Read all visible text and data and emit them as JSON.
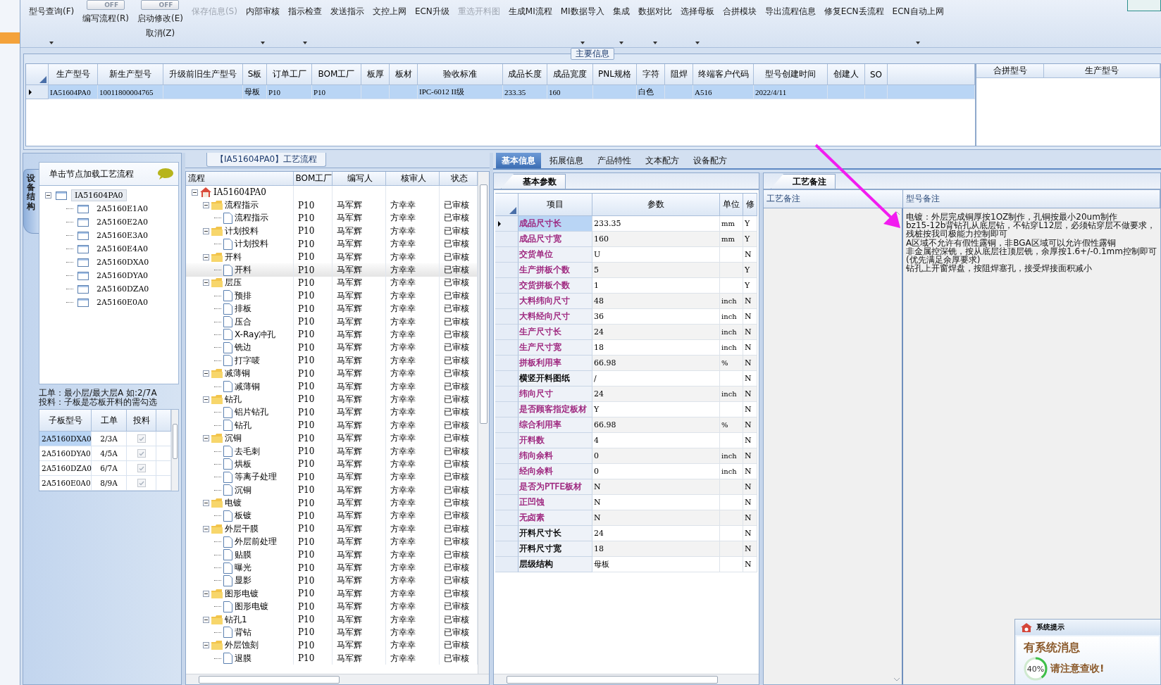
{
  "toolbar": [
    {
      "kind": "button",
      "label": "型号查询(F)",
      "menu": true,
      "disabled": false
    },
    {
      "kind": "toggle",
      "switch": "OFF",
      "on": false,
      "label": "编写流程(R)",
      "menu": false,
      "disabled": false
    },
    {
      "kind": "toggle",
      "switch": "OFF",
      "on": false,
      "label": "启动修改(E)",
      "sublabel": "取消(Z)",
      "menu": false,
      "disabled": false
    },
    {
      "kind": "button",
      "label": "保存信息(S)",
      "menu": false,
      "disabled": true
    },
    {
      "kind": "button",
      "label": "内部审核",
      "menu": true,
      "disabled": false
    },
    {
      "kind": "button",
      "label": "指示检查",
      "menu": true,
      "disabled": false
    },
    {
      "kind": "button",
      "label": "发送指示",
      "menu": false,
      "disabled": false
    },
    {
      "kind": "button",
      "label": "文控上网",
      "menu": false,
      "disabled": false
    },
    {
      "kind": "button",
      "label": "ECN升级",
      "menu": false,
      "disabled": false
    },
    {
      "kind": "button",
      "label": "重选开料图",
      "menu": false,
      "disabled": true
    },
    {
      "kind": "button",
      "label": "生成MI流程",
      "menu": false,
      "disabled": false
    },
    {
      "kind": "button",
      "label": "MI数据导入",
      "menu": true,
      "disabled": false
    },
    {
      "kind": "button",
      "label": "集成",
      "menu": true,
      "disabled": false
    },
    {
      "kind": "button",
      "label": "数据对比",
      "menu": true,
      "disabled": false
    },
    {
      "kind": "button",
      "label": "选择母板",
      "menu": true,
      "disabled": false
    },
    {
      "kind": "button",
      "label": "合拼模块",
      "menu": false,
      "disabled": false
    },
    {
      "kind": "button",
      "label": "导出流程信息",
      "menu": false,
      "disabled": false
    },
    {
      "kind": "button",
      "label": "修复ECN丢流程",
      "menu": false,
      "disabled": false
    },
    {
      "kind": "button",
      "label": "ECN自动上网",
      "menu": true,
      "disabled": false
    }
  ],
  "main_info": {
    "title": "主要信息",
    "columns": [
      "生产型号",
      "新生产型号",
      "升级前旧生产型号",
      "S板",
      "订单工厂",
      "BOM工厂",
      "板厚",
      "板材",
      "验收标准",
      "成品长度",
      "成品宽度",
      "PNL规格",
      "字符",
      "阻焊",
      "终端客户代码",
      "型号创建时间",
      "创建人",
      "SO"
    ],
    "rows": [
      {
        "selected": true,
        "cells": [
          "IA51604PA0",
          "10011800004765",
          null,
          "母板",
          "P10",
          "P10",
          null,
          null,
          "IPC-6012 II级",
          "233.35",
          "160",
          null,
          "白色",
          null,
          "A516",
          "2022/4/11",
          null,
          null
        ]
      }
    ],
    "merge_columns": [
      "合拼型号",
      "生产型号"
    ]
  },
  "structure_panel": {
    "side_tab": "设备结构",
    "header": "单击节点加载工艺流程",
    "tree": {
      "label": "IA51604PA0",
      "expanded": true,
      "selected": true,
      "children": [
        {
          "label": "2A5160E1A0",
          "selected": false
        },
        {
          "label": "2A5160E2A0",
          "selected": false
        },
        {
          "label": "2A5160E3A0",
          "selected": false
        },
        {
          "label": "2A5160E4A0",
          "selected": false
        },
        {
          "label": "2A5160DXA0",
          "selected": false
        },
        {
          "label": "2A5160DYA0",
          "selected": false
        },
        {
          "label": "2A5160DZA0",
          "selected": false
        },
        {
          "label": "2A5160E0A0",
          "selected": false
        }
      ]
    },
    "hint": "工单：最小层/最大层A 如:2/7A\n投料：子板是芯板开料的需勾选",
    "columns": [
      "子板型号",
      "工单",
      "投料"
    ],
    "rows": [
      {
        "board": "2A5160DXA0",
        "order": "2/3A",
        "feed": true,
        "selected": true
      },
      {
        "board": "2A5160DYA0",
        "order": "4/5A",
        "feed": true,
        "selected": false
      },
      {
        "board": "2A5160DZA0",
        "order": "6/7A",
        "feed": true,
        "selected": false
      },
      {
        "board": "2A5160E0A0",
        "order": "8/9A",
        "feed": true,
        "selected": false
      }
    ]
  },
  "flow_panel": {
    "title": "【IA51604PA0】工艺流程",
    "columns": [
      "流程",
      "BOM工厂",
      "编写人",
      "核审人",
      "状态"
    ],
    "tree": {
      "kind": "root",
      "label": "IA51604PA0",
      "expanded": true,
      "selected": false,
      "children": [
        {
          "kind": "folder",
          "label": "流程指示",
          "bom": "P10",
          "author": "马军辉",
          "reviewer": "方幸幸",
          "status": "已审核",
          "expanded": true,
          "selected": false,
          "children": [
            {
              "kind": "step",
              "label": "流程指示",
              "bom": "P10",
              "author": "马军辉",
              "reviewer": "方幸幸",
              "status": "已审核",
              "selected": false
            }
          ]
        },
        {
          "kind": "folder",
          "label": "计划投料",
          "bom": "P10",
          "author": "马军辉",
          "reviewer": "方幸幸",
          "status": "已审核",
          "expanded": true,
          "selected": false,
          "children": [
            {
              "kind": "step",
              "label": "计划投料",
              "bom": "P10",
              "author": "马军辉",
              "reviewer": "方幸幸",
              "status": "已审核",
              "selected": false
            }
          ]
        },
        {
          "kind": "folder",
          "label": "开料",
          "bom": "P10",
          "author": "马军辉",
          "reviewer": "方幸幸",
          "status": "已审核",
          "expanded": true,
          "selected": false,
          "children": [
            {
              "kind": "step",
              "label": "开料",
              "bom": "P10",
              "author": "马军辉",
              "reviewer": "方幸幸",
              "status": "已审核",
              "selected": true
            }
          ]
        },
        {
          "kind": "folder",
          "label": "层压",
          "bom": "P10",
          "author": "马军辉",
          "reviewer": "方幸幸",
          "status": "已审核",
          "expanded": true,
          "selected": false,
          "children": [
            {
              "kind": "step",
              "label": "预排",
              "bom": "P10",
              "author": "马军辉",
              "reviewer": "方幸幸",
              "status": "已审核",
              "selected": false
            },
            {
              "kind": "step",
              "label": "排板",
              "bom": "P10",
              "author": "马军辉",
              "reviewer": "方幸幸",
              "status": "已审核",
              "selected": false
            },
            {
              "kind": "step",
              "label": "压合",
              "bom": "P10",
              "author": "马军辉",
              "reviewer": "方幸幸",
              "status": "已审核",
              "selected": false
            },
            {
              "kind": "step",
              "label": "X-Ray冲孔",
              "bom": "P10",
              "author": "马军辉",
              "reviewer": "方幸幸",
              "status": "已审核",
              "selected": false
            },
            {
              "kind": "step",
              "label": "铣边",
              "bom": "P10",
              "author": "马军辉",
              "reviewer": "方幸幸",
              "status": "已审核",
              "selected": false
            },
            {
              "kind": "step",
              "label": "打字唛",
              "bom": "P10",
              "author": "马军辉",
              "reviewer": "方幸幸",
              "status": "已审核",
              "selected": false
            }
          ]
        },
        {
          "kind": "folder",
          "label": "减薄铜",
          "bom": "P10",
          "author": "马军辉",
          "reviewer": "方幸幸",
          "status": "已审核",
          "expanded": true,
          "selected": false,
          "children": [
            {
              "kind": "step",
              "label": "减薄铜",
              "bom": "P10",
              "author": "马军辉",
              "reviewer": "方幸幸",
              "status": "已审核",
              "selected": false
            }
          ]
        },
        {
          "kind": "folder",
          "label": "钻孔",
          "bom": "P10",
          "author": "马军辉",
          "reviewer": "方幸幸",
          "status": "已审核",
          "expanded": true,
          "selected": false,
          "children": [
            {
              "kind": "step",
              "label": "铝片钻孔",
              "bom": "P10",
              "author": "马军辉",
              "reviewer": "方幸幸",
              "status": "已审核",
              "selected": false
            },
            {
              "kind": "step",
              "label": "钻孔",
              "bom": "P10",
              "author": "马军辉",
              "reviewer": "方幸幸",
              "status": "已审核",
              "selected": false
            }
          ]
        },
        {
          "kind": "folder",
          "label": "沉铜",
          "bom": "P10",
          "author": "马军辉",
          "reviewer": "方幸幸",
          "status": "已审核",
          "expanded": true,
          "selected": false,
          "children": [
            {
              "kind": "step",
              "label": "去毛刺",
              "bom": "P10",
              "author": "马军辉",
              "reviewer": "方幸幸",
              "status": "已审核",
              "selected": false
            },
            {
              "kind": "step",
              "label": "烘板",
              "bom": "P10",
              "author": "马军辉",
              "reviewer": "方幸幸",
              "status": "已审核",
              "selected": false
            },
            {
              "kind": "step",
              "label": "等离子处理",
              "bom": "P10",
              "author": "马军辉",
              "reviewer": "方幸幸",
              "status": "已审核",
              "selected": false
            },
            {
              "kind": "step",
              "label": "沉铜",
              "bom": "P10",
              "author": "马军辉",
              "reviewer": "方幸幸",
              "status": "已审核",
              "selected": false
            }
          ]
        },
        {
          "kind": "folder",
          "label": "电镀",
          "bom": "P10",
          "author": "马军辉",
          "reviewer": "方幸幸",
          "status": "已审核",
          "expanded": true,
          "selected": false,
          "children": [
            {
              "kind": "step",
              "label": "板镀",
              "bom": "P10",
              "author": "马军辉",
              "reviewer": "方幸幸",
              "status": "已审核",
              "selected": false
            }
          ]
        },
        {
          "kind": "folder",
          "label": "外层干膜",
          "bom": "P10",
          "author": "马军辉",
          "reviewer": "方幸幸",
          "status": "已审核",
          "expanded": true,
          "selected": false,
          "children": [
            {
              "kind": "step",
              "label": "外层前处理",
              "bom": "P10",
              "author": "马军辉",
              "reviewer": "方幸幸",
              "status": "已审核",
              "selected": false
            },
            {
              "kind": "step",
              "label": "贴膜",
              "bom": "P10",
              "author": "马军辉",
              "reviewer": "方幸幸",
              "status": "已审核",
              "selected": false
            },
            {
              "kind": "step",
              "label": "曝光",
              "bom": "P10",
              "author": "马军辉",
              "reviewer": "方幸幸",
              "status": "已审核",
              "selected": false
            },
            {
              "kind": "step",
              "label": "显影",
              "bom": "P10",
              "author": "马军辉",
              "reviewer": "方幸幸",
              "status": "已审核",
              "selected": false
            }
          ]
        },
        {
          "kind": "folder",
          "label": "图形电镀",
          "bom": "P10",
          "author": "马军辉",
          "reviewer": "方幸幸",
          "status": "已审核",
          "expanded": true,
          "selected": false,
          "children": [
            {
              "kind": "step",
              "label": "图形电镀",
              "bom": "P10",
              "author": "马军辉",
              "reviewer": "方幸幸",
              "status": "已审核",
              "selected": false
            }
          ]
        },
        {
          "kind": "folder",
          "label": "钻孔1",
          "bom": "P10",
          "author": "马军辉",
          "reviewer": "方幸幸",
          "status": "已审核",
          "expanded": true,
          "selected": false,
          "children": [
            {
              "kind": "step",
              "label": "背钻",
              "bom": "P10",
              "author": "马军辉",
              "reviewer": "方幸幸",
              "status": "已审核",
              "selected": false
            }
          ]
        },
        {
          "kind": "folder",
          "label": "外层蚀刻",
          "bom": "P10",
          "author": "马军辉",
          "reviewer": "方幸幸",
          "status": "已审核",
          "expanded": true,
          "selected": false,
          "children": [
            {
              "kind": "step",
              "label": "退膜",
              "bom": "P10",
              "author": "马军辉",
              "reviewer": "方幸幸",
              "status": "已审核",
              "selected": false
            }
          ]
        }
      ]
    }
  },
  "detail_tabs": [
    {
      "label": "基本信息",
      "selected": true
    },
    {
      "label": "拓展信息",
      "selected": false
    },
    {
      "label": "产品特性",
      "selected": false
    },
    {
      "label": "文本配方",
      "selected": false
    },
    {
      "label": "设备配方",
      "selected": false
    }
  ],
  "params": {
    "tab": "基本参数",
    "columns": [
      "项目",
      "参数",
      "单位",
      "修"
    ],
    "rows": [
      {
        "name": "成品尺寸长",
        "value": "233.35",
        "unit": "mm",
        "flag": "Y",
        "color": "#9b1f7a",
        "selected": true
      },
      {
        "name": "成品尺寸宽",
        "value": "160",
        "unit": "mm",
        "flag": "Y",
        "color": "#9b1f7a",
        "selected": false
      },
      {
        "name": "交货单位",
        "value": "U",
        "flag": "N",
        "color": "#9b1f7a",
        "selected": false
      },
      {
        "name": "生产拼板个数",
        "value": "5",
        "flag": "Y",
        "color": "#9b1f7a",
        "selected": false
      },
      {
        "name": "交货拼板个数",
        "value": "1",
        "flag": "Y",
        "color": "#9b1f7a",
        "selected": false
      },
      {
        "name": "大料纬向尺寸",
        "value": "48",
        "unit": "inch",
        "flag": "N",
        "color": "#9b1f7a",
        "selected": false
      },
      {
        "name": "大料经向尺寸",
        "value": "36",
        "unit": "inch",
        "flag": "N",
        "color": "#9b1f7a",
        "selected": false
      },
      {
        "name": "生产尺寸长",
        "value": "24",
        "unit": "inch",
        "flag": "N",
        "color": "#9b1f7a",
        "selected": false
      },
      {
        "name": "生产尺寸宽",
        "value": "18",
        "unit": "inch",
        "flag": "N",
        "color": "#9b1f7a",
        "selected": false
      },
      {
        "name": "拼板利用率",
        "value": "66.98",
        "unit": "%",
        "flag": "N",
        "color": "#9b1f7a",
        "selected": false
      },
      {
        "name": "横竖开料图纸",
        "value": "/",
        "flag": "N",
        "color": "#000000",
        "selected": false
      },
      {
        "name": "纬向尺寸",
        "value": "24",
        "unit": "inch",
        "flag": "N",
        "color": "#9b1f7a",
        "selected": false
      },
      {
        "name": "是否顾客指定板材",
        "value": "Y",
        "flag": "N",
        "color": "#9b1f7a",
        "selected": false
      },
      {
        "name": "综合利用率",
        "value": "66.98",
        "unit": "%",
        "flag": "N",
        "color": "#9b1f7a",
        "selected": false
      },
      {
        "name": "开料数",
        "value": "4",
        "flag": "N",
        "color": "#9b1f7a",
        "selected": false
      },
      {
        "name": "纬向余料",
        "value": "0",
        "unit": "inch",
        "flag": "N",
        "color": "#9b1f7a",
        "selected": false
      },
      {
        "name": "经向余料",
        "value": "0",
        "unit": "inch",
        "flag": "N",
        "color": "#9b1f7a",
        "selected": false
      },
      {
        "name": "是否为PTFE板材",
        "value": "N",
        "flag": "N",
        "color": "#9b1f7a",
        "selected": false
      },
      {
        "name": "正凹蚀",
        "value": "N",
        "flag": "N",
        "color": "#9b1f7a",
        "selected": false
      },
      {
        "name": "无卤素",
        "value": "N",
        "flag": "N",
        "color": "#9b1f7a",
        "selected": false
      },
      {
        "name": "开料尺寸长",
        "value": "24",
        "flag": "N",
        "color": "#000000",
        "selected": false
      },
      {
        "name": "开料尺寸宽",
        "value": "18",
        "flag": "N",
        "color": "#000000",
        "selected": false
      },
      {
        "name": "层级结构",
        "value": "母板",
        "flag": "N",
        "color": "#000000",
        "selected": false
      }
    ]
  },
  "remarks": {
    "tab": "工艺备注",
    "columns": [
      "工艺备注",
      "型号备注"
    ],
    "model_remark": [
      "电镀：外层完成铜厚按1OZ制作，孔铜按最小20um制作",
      "bz15-12b背钻孔从底层钻，不钻穿L12层，必须钻穿层不做要求，残桩按我司极能力控制即可",
      "A区域不允许有假性露铜，非BGA区域可以允许假性露铜",
      "非金属控深铣，按从底层往顶层铣，余厚按1.6+/-0.1mm控制即可(优先满足余厚要求)",
      "钻孔上开窗焊盘，按阻焊塞孔，接受焊接面积减小"
    ]
  },
  "notification": {
    "title": "系统提示",
    "message": "有系统消息",
    "progress": "40%",
    "level": 0.4,
    "note": "请注意查收!"
  }
}
